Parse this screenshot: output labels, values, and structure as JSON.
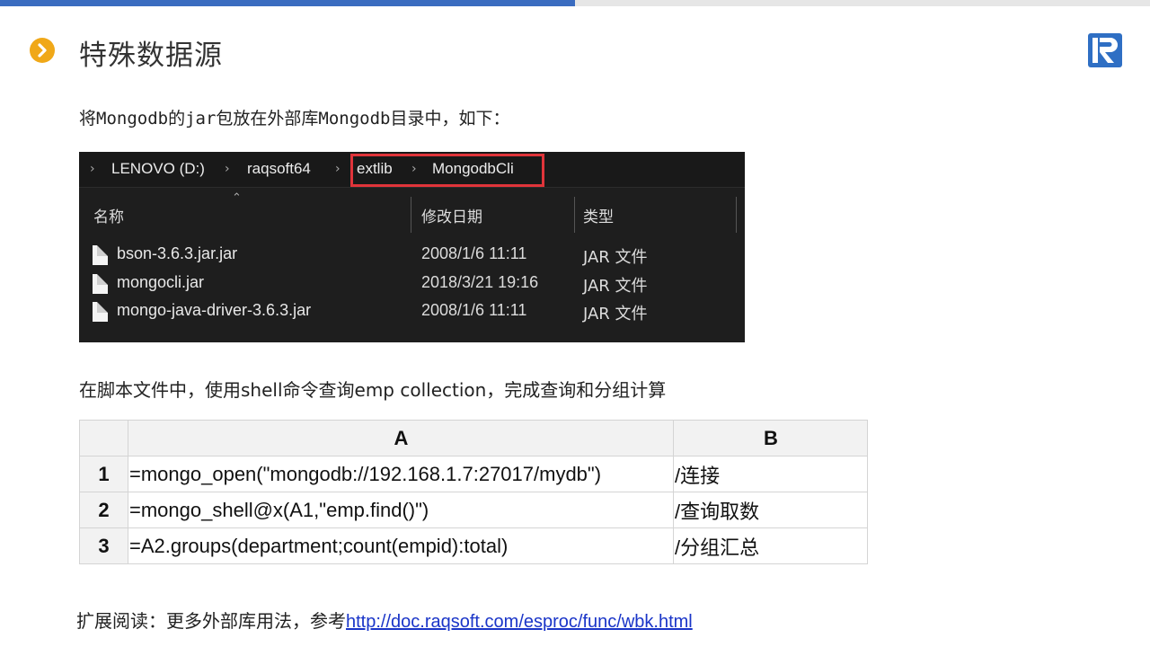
{
  "header": {
    "title": "特殊数据源"
  },
  "intro_text": "将Mongodb的jar包放在外部库Mongodb目录中，如下：",
  "explorer": {
    "breadcrumb": [
      "LENOVO (D:)",
      "raqsoft64",
      "extlib",
      "MongodbCli"
    ],
    "columns": [
      "名称",
      "修改日期",
      "类型"
    ],
    "files": [
      {
        "name": "bson-3.6.3.jar.jar",
        "date": "2008/1/6 11:11",
        "type": "JAR 文件"
      },
      {
        "name": "mongocli.jar",
        "date": "2018/3/21 19:16",
        "type": "JAR 文件"
      },
      {
        "name": "mongo-java-driver-3.6.3.jar",
        "date": "2008/1/6 11:11",
        "type": "JAR 文件"
      }
    ]
  },
  "description": "在脚本文件中，使用shell命令查询emp collection，完成查询和分组计算",
  "grid": {
    "columns": [
      "A",
      "B"
    ],
    "rows": [
      {
        "num": "1",
        "a": "=mongo_open(\"mongodb://192.168.1.7:27017/mydb\")",
        "b": "/连接"
      },
      {
        "num": "2",
        "a": "=mongo_shell@x(A1,\"emp.find()\")",
        "b": "/查询取数"
      },
      {
        "num": "3",
        "a": "=A2.groups(department;count(empid):total)",
        "b": "/分组汇总"
      }
    ]
  },
  "footer": {
    "label": "扩展阅读：更多外部库用法，参考",
    "link": "http://doc.raqsoft.com/esproc/func/wbk.html"
  },
  "colors": {
    "accent_blue": "#3a6cc0",
    "bullet_orange": "#f0a818",
    "highlight_red": "#e0343a",
    "link_blue": "#1a35c8"
  }
}
